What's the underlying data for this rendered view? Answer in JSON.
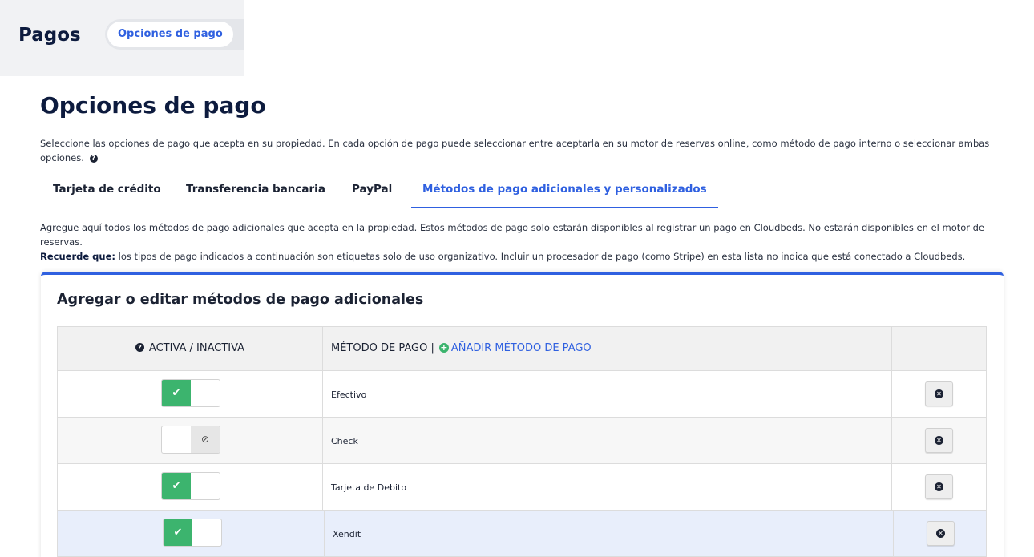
{
  "header": {
    "title": "Pagos",
    "subtabs": [
      {
        "label": "Opciones de pago",
        "active": true
      }
    ]
  },
  "page": {
    "title": "Opciones de pago",
    "intro": "Seleccione las opciones de pago que acepta en su propiedad. En cada opción de pago puede seleccionar entre aceptarla en su motor de reservas online, como método de pago interno o seleccionar ambas opciones."
  },
  "tabs": [
    {
      "label": "Tarjeta de crédito",
      "active": false
    },
    {
      "label": "Transferencia bancaria",
      "active": false
    },
    {
      "label": "PayPal",
      "active": false
    },
    {
      "label": "Métodos de pago adicionales y personalizados",
      "active": true
    }
  ],
  "description": {
    "text": "Agregue aquí todos los métodos de pago adicionales que acepta en la propiedad. Estos métodos de pago solo estarán disponibles al registrar un pago en Cloudbeds. No estarán disponibles en el motor de reservas.",
    "reminder_label": "Recuerde que:",
    "reminder_text": " los tipos de pago indicados a continuación son etiquetas solo de uso organizativo. Incluir un procesador de pago (como Stripe) en esta lista no indica que está conectado a Cloudbeds."
  },
  "panel": {
    "title": "Agregar o editar métodos de pago adicionales",
    "table": {
      "col_status": "ACTIVA / INACTIVA",
      "col_method": "MÉTODO DE PAGO |",
      "add_label": "AÑADIR MÉTODO DE PAGO",
      "rows": [
        {
          "name": "Efectivo",
          "active": true
        },
        {
          "name": "Check",
          "active": false
        },
        {
          "name": "Tarjeta de Debito",
          "active": true
        },
        {
          "name": "Xendit",
          "active": true
        }
      ]
    }
  },
  "icons": {
    "help": "question-circle-icon",
    "add": "plus-circle-icon",
    "on": "check-icon",
    "off": "ban-icon",
    "delete": "times-circle-icon"
  },
  "colors": {
    "accent": "#2f60e0",
    "success": "#3cb46e",
    "heading": "#0d1b3e"
  }
}
